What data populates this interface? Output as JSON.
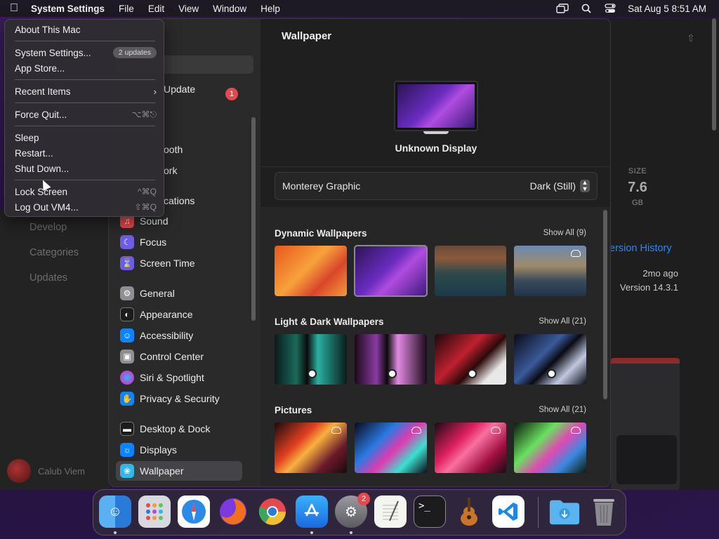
{
  "menubar": {
    "app_name": "System Settings",
    "menus": [
      "File",
      "Edit",
      "View",
      "Window",
      "Help"
    ],
    "clock": "Sat Aug 5  8:51 AM"
  },
  "apple_menu": {
    "about": "About This Mac",
    "system_settings": "System Settings...",
    "updates_badge": "2 updates",
    "app_store": "App Store...",
    "recent_items": "Recent Items",
    "force_quit": "Force Quit...",
    "force_quit_shortcut": "⌥⌘⎋",
    "sleep": "Sleep",
    "restart": "Restart...",
    "shut_down": "Shut Down...",
    "lock_screen": "Lock Screen",
    "lock_screen_shortcut": "^⌘Q",
    "log_out": "Log Out VM4...",
    "log_out_shortcut": "⇧⌘Q"
  },
  "sidebar": {
    "partial_update": "Update",
    "partial_bluetooth": "ooth",
    "partial_network": "ork",
    "partial_notifications": "cations",
    "update_badge": "1",
    "items": [
      {
        "label": "Sound",
        "icon": "sound-icon",
        "color": "#e5484d"
      },
      {
        "label": "Focus",
        "icon": "moon-icon",
        "color": "#6e5ce6"
      },
      {
        "label": "Screen Time",
        "icon": "hourglass-icon",
        "color": "#6e5ce6"
      },
      {
        "label": "General",
        "icon": "gear-icon",
        "color": "#8e8e93"
      },
      {
        "label": "Appearance",
        "icon": "appearance-icon",
        "color": "#1c1c1e"
      },
      {
        "label": "Accessibility",
        "icon": "accessibility-icon",
        "color": "#0a84ff"
      },
      {
        "label": "Control Center",
        "icon": "control-center-icon",
        "color": "#8e8e93"
      },
      {
        "label": "Siri & Spotlight",
        "icon": "siri-icon",
        "color": "#b04ce0"
      },
      {
        "label": "Privacy & Security",
        "icon": "hand-icon",
        "color": "#0a84ff"
      },
      {
        "label": "Desktop & Dock",
        "icon": "dock-icon",
        "color": "#1c1c1e"
      },
      {
        "label": "Displays",
        "icon": "displays-icon",
        "color": "#0a84ff"
      },
      {
        "label": "Wallpaper",
        "icon": "wallpaper-icon",
        "color": "#2fb8e8"
      }
    ]
  },
  "wallpaper": {
    "title": "Wallpaper",
    "display_name": "Unknown Display",
    "current": "Monterey Graphic",
    "mode": "Dark (Still)",
    "sections": [
      {
        "name": "Dynamic Wallpapers",
        "show_all": "Show All (9)"
      },
      {
        "name": "Light & Dark Wallpapers",
        "show_all": "Show All (21)"
      },
      {
        "name": "Pictures",
        "show_all": "Show All (21)"
      }
    ]
  },
  "background_store": {
    "size_label": "SIZE",
    "size_value": "7.6",
    "size_unit": "GB",
    "version_history": "ersion History",
    "ago": "2mo ago",
    "version": "Version 14.3.1",
    "nav": [
      "Develop",
      "Categories",
      "Updates"
    ],
    "user": "Calub Viem"
  },
  "dock": {
    "settings_badge": "2",
    "apps": [
      "Finder",
      "Launchpad",
      "Safari",
      "Firefox",
      "Chrome",
      "App Store",
      "System Settings",
      "TextEdit",
      "Terminal",
      "GarageBand",
      "VS Code",
      "Downloads",
      "Trash"
    ]
  }
}
